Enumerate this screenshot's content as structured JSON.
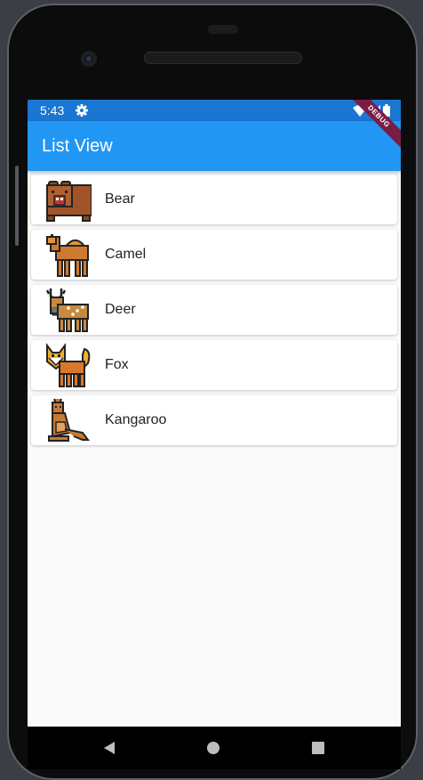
{
  "status_bar": {
    "time": "5:43",
    "icons": [
      "settings-gear-icon",
      "wifi-icon",
      "signal-icon",
      "battery-icon"
    ]
  },
  "app_bar": {
    "title": "List View",
    "debug_banner": "DEBUG"
  },
  "animals": [
    {
      "label": "Bear",
      "icon": "bear-icon"
    },
    {
      "label": "Camel",
      "icon": "camel-icon"
    },
    {
      "label": "Deer",
      "icon": "deer-icon"
    },
    {
      "label": "Fox",
      "icon": "fox-icon"
    },
    {
      "label": "Kangaroo",
      "icon": "kangaroo-icon"
    }
  ],
  "nav_bar": {
    "icons": [
      "back-icon",
      "home-icon",
      "recent-apps-icon"
    ]
  },
  "colors": {
    "app_bar": "#2196f3",
    "status_bar": "#1976d2",
    "debug_banner": "#7a1d46",
    "background": "#fafafa"
  }
}
